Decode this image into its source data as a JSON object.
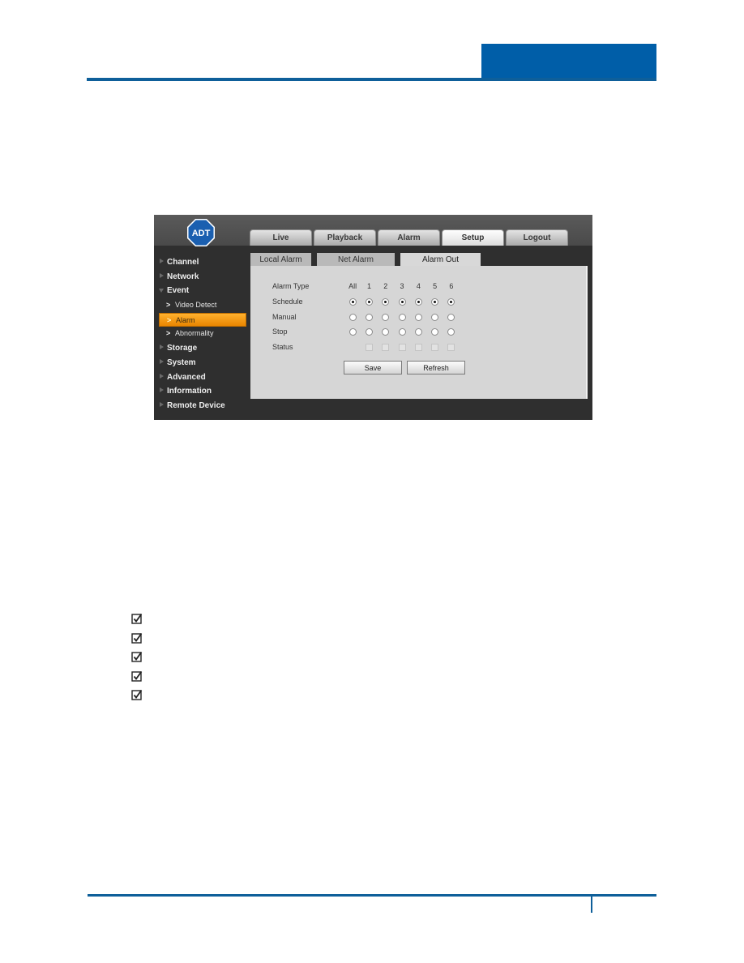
{
  "page": {
    "header_accent_color": "#005ea8",
    "rule_color": "#0e5f9a"
  },
  "app": {
    "logo_text": "ADT",
    "main_tabs": [
      {
        "label": "Live",
        "active": false
      },
      {
        "label": "Playback",
        "active": false
      },
      {
        "label": "Alarm",
        "active": false
      },
      {
        "label": "Setup",
        "active": true
      },
      {
        "label": "Logout",
        "active": false
      }
    ],
    "sidebar": [
      {
        "label": "Channel",
        "type": "group",
        "expanded": false
      },
      {
        "label": "Network",
        "type": "group",
        "expanded": false
      },
      {
        "label": "Event",
        "type": "group",
        "expanded": true
      },
      {
        "label": "Video Detect",
        "type": "sub",
        "active": false
      },
      {
        "label": "Alarm",
        "type": "sub",
        "active": true
      },
      {
        "label": "Abnormality",
        "type": "sub",
        "active": false
      },
      {
        "label": "Storage",
        "type": "group",
        "expanded": false
      },
      {
        "label": "System",
        "type": "group",
        "expanded": false
      },
      {
        "label": "Advanced",
        "type": "group",
        "expanded": false
      },
      {
        "label": "Information",
        "type": "group",
        "expanded": false
      },
      {
        "label": "Remote Device",
        "type": "group",
        "expanded": false
      }
    ],
    "sub_tabs": [
      {
        "label": "Local Alarm",
        "active": false
      },
      {
        "label": "Net Alarm",
        "active": false
      },
      {
        "label": "Alarm Out",
        "active": true
      }
    ],
    "alarm_out": {
      "header_label": "Alarm Type",
      "columns": [
        "All",
        "1",
        "2",
        "3",
        "4",
        "5",
        "6"
      ],
      "rows": [
        {
          "label": "Schedule",
          "selected": [
            true,
            true,
            true,
            true,
            true,
            true,
            true
          ]
        },
        {
          "label": "Manual",
          "selected": [
            false,
            false,
            false,
            false,
            false,
            false,
            false
          ]
        },
        {
          "label": "Stop",
          "selected": [
            false,
            false,
            false,
            false,
            false,
            false,
            false
          ]
        }
      ],
      "status_label": "Status",
      "status": [
        false,
        false,
        false,
        false,
        false,
        false
      ]
    },
    "buttons": {
      "save": "Save",
      "refresh": "Refresh"
    },
    "highlight_color": "#f39a10"
  },
  "checklist": {
    "count": 5,
    "icon": "checked-box-icon"
  }
}
